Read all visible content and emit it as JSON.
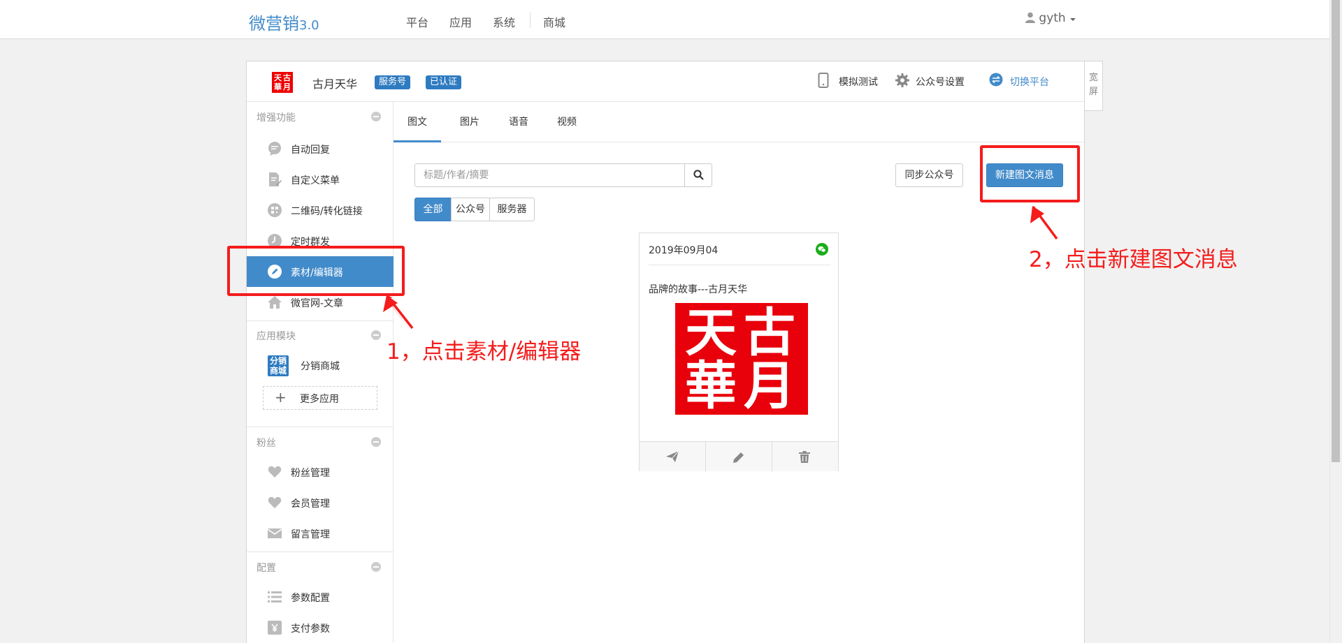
{
  "brand": {
    "name": "微营销",
    "version": "3.0"
  },
  "topnav": {
    "items": [
      "平台",
      "应用",
      "系统",
      "商城"
    ],
    "user": "gyth"
  },
  "wide_screen_label": "宽\n屏",
  "account": {
    "logo_chars": [
      "天",
      "古",
      "華",
      "月"
    ],
    "name": "古月天华",
    "badges": [
      "服务号",
      "已认证"
    ],
    "actions": {
      "simulate": "模拟测试",
      "settings": "公众号设置",
      "switch": "切换平台"
    }
  },
  "sidebar": {
    "sections": [
      {
        "title": "增强功能",
        "items": [
          "自动回复",
          "自定义菜单",
          "二维码/转化链接",
          "定时群发",
          "素材/编辑器",
          "微官网-文章"
        ]
      },
      {
        "title": "应用模块",
        "app": {
          "icon_text": "分销\n商城",
          "label": "分销商城"
        },
        "more": "更多应用"
      },
      {
        "title": "粉丝",
        "items": [
          "粉丝管理",
          "会员管理",
          "留言管理"
        ]
      },
      {
        "title": "配置",
        "items": [
          "参数配置",
          "支付参数"
        ]
      }
    ]
  },
  "tabs": [
    "图文",
    "图片",
    "语音",
    "视频"
  ],
  "search": {
    "placeholder": "标题/作者/摘要"
  },
  "buttons": {
    "sync": "同步公众号",
    "new_news": "新建图文消息"
  },
  "filters": [
    "全部",
    "公众号",
    "服务器"
  ],
  "news_card": {
    "date": "2019年09月04",
    "title": "品牌的故事---古月天华",
    "image_chars": [
      "天",
      "古",
      "華",
      "月"
    ]
  },
  "annotations": {
    "step1": "1，点击素材/编辑器",
    "step2": "2，点击新建图文消息",
    "color": "#f41c1c"
  },
  "colors": {
    "primary": "#428bca",
    "brand_red": "#e8000b",
    "wechat_green": "#1aad19"
  }
}
